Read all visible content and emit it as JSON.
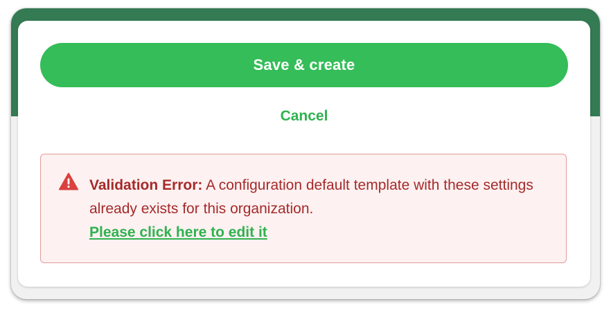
{
  "dialog": {
    "save_button_label": "Save & create",
    "cancel_label": "Cancel"
  },
  "alert": {
    "icon": "warning-triangle-icon",
    "title": "Validation Error:",
    "message": "A configuration default template with these settings already exists for this organization.",
    "link_label": "Please click here to edit it"
  },
  "colors": {
    "header_band": "#347a53",
    "primary_green": "#34bd58",
    "link_green": "#2fb24f",
    "error_text": "#a52a2a",
    "error_bg": "#fdf1f1",
    "error_border": "#e39a9a",
    "icon_red": "#d9413f"
  }
}
